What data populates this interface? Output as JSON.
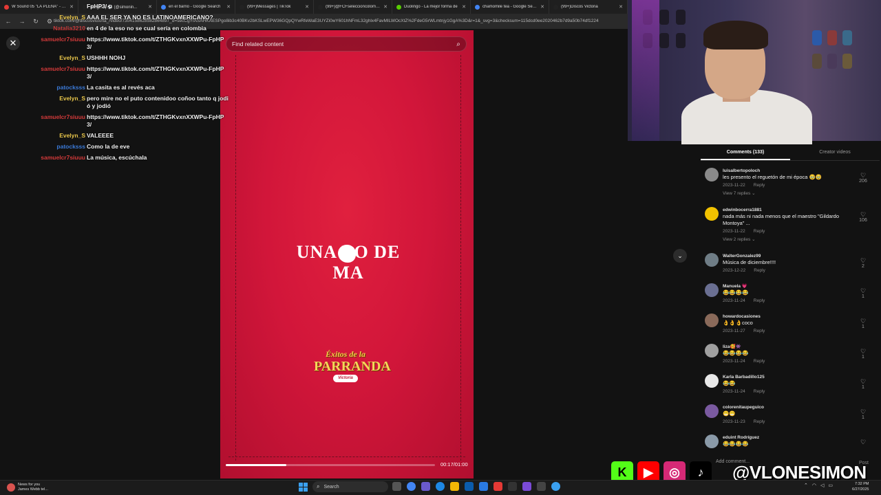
{
  "browser": {
    "tabs": [
      {
        "label": "W Sound 05 \"LA PLENA\" - Bedi",
        "color": "#e53935"
      },
      {
        "label": "(English) ⚽ (@simonin...",
        "color": "#222222"
      },
      {
        "label": "en el barrio - Google Search",
        "color": "#4285f4"
      },
      {
        "label": "(99+)Messages | TikTok",
        "color": "#222222"
      },
      {
        "label": "(99+)@FCFseleccioncolombia |",
        "color": "#222222"
      },
      {
        "label": "Duolingo - La mejor forma de",
        "color": "#58cc02"
      },
      {
        "label": "chamomile tea - Google Search",
        "color": "#4285f4"
      },
      {
        "label": "(99+)Discos Victoria",
        "color": "#222222"
      }
    ],
    "url": "tiktok.com/@discosvictoria_/video/7304158628582864897_d=secCgYIASAHKAESPgo8ib3c40BKv2bKSLwEPW36GQpQYwRfeWaE3UYZi0wY601hNFmL32ghlx4FavMILWOcXtZ%2FdeG5rWLmtnjy1GgA%3D&r=1&_svg=3&checksum=115dcd0ee2020462b7d9a50b74df1224"
  },
  "chat": [
    {
      "user": "",
      "message": "FpHP3/",
      "color": "#ffffff"
    },
    {
      "user": "Evelyn_S",
      "message": "AAA EL SER YA NO ES LATINOAMERICANO?",
      "color": "#e8c54a"
    },
    {
      "user": "Natalia3210",
      "message": "en 4 de la eso no se cual sería en colombia",
      "color": "#c43b3b"
    },
    {
      "user": "samuelcr7siuuu",
      "message": "https://www.tiktok.com/t/ZTHGKvxnXXWPu-FpHP3/",
      "color": "#d43a3a"
    },
    {
      "user": "Evelyn_S",
      "message": "USHHH NOHJ",
      "color": "#e8c54a"
    },
    {
      "user": "samuelcr7siuuu",
      "message": "https://www.tiktok.com/t/ZTHGKvxnXXWPu-FpHP3/",
      "color": "#d43a3a"
    },
    {
      "user": "patocksss",
      "message": "La casita es al revés aca",
      "color": "#3b7ad8"
    },
    {
      "user": "Evelyn_S",
      "message": "pero mire no el puto contenidoo coñoo tanto q jodió y jodió",
      "color": "#e8c54a"
    },
    {
      "user": "samuelcr7siuuu",
      "message": "https://www.tiktok.com/t/ZTHGKvxnXXWPu-FpHP3/",
      "color": "#d43a3a"
    },
    {
      "user": "Evelyn_S",
      "message": "VALEEEE",
      "color": "#e8c54a"
    },
    {
      "user": "patocksss",
      "message": "Como la de eve",
      "color": "#3b7ad8"
    },
    {
      "user": "samuelcr7siuuu",
      "message": "La música, escúchala",
      "color": "#d43a3a"
    }
  ],
  "video": {
    "search_placeholder": "Find related content",
    "overlay_text": "UNA BO  DE MA",
    "logo_line1": "Éxitos de la",
    "logo_line2": "PARRANDA",
    "logo_badge": "Victoria",
    "time": "00:17/01:00",
    "progress": 0.29
  },
  "comments_panel": {
    "tab_comments": "Comments (133)",
    "tab_creator": "Creator videos",
    "input_placeholder": "Add comment...",
    "post_label": "Post",
    "reply_label": "Reply",
    "comments": [
      {
        "user": "luisalbertopoloch",
        "text": "les presento el reguetón de mi época 🥹🥹",
        "date": "2023-11-22",
        "likes": "206",
        "replies": "View 7 replies ⌄",
        "avatar": "#8a8a8a"
      },
      {
        "user": "edwinbocerra1881",
        "text": "nada más ni nada menos que el maestro \"Gildardo Montoya\" ...",
        "date": "2023-11-22",
        "likes": "106",
        "replies": "View 2 replies ⌄",
        "avatar": "#f2c200"
      },
      {
        "user": "WalterGonzalez99",
        "text": "Música de diciembre!!!!",
        "date": "2023-12-22",
        "likes": "2",
        "replies": "",
        "avatar": "#6f7d86"
      },
      {
        "user": "Manuela 💗",
        "text": "😂😂😂😂",
        "date": "2023-11-24",
        "likes": "1",
        "replies": "",
        "avatar": "#6a6f92"
      },
      {
        "user": "howardocasiones",
        "text": "👌👌👌coco",
        "date": "2023-11-27",
        "likes": "1",
        "replies": "",
        "avatar": "#8a6a5a"
      },
      {
        "user": "liza🥰👾",
        "text": "😂😂😂😂",
        "date": "2023-11-24",
        "likes": "1",
        "replies": "",
        "avatar": "#a0a0a0"
      },
      {
        "user": "Karla Barbadillo125",
        "text": "😂😂",
        "date": "2023-11-24",
        "likes": "1",
        "replies": "",
        "avatar": "#e8e8e8"
      },
      {
        "user": "colorenitaupeguico",
        "text": "😁😁",
        "date": "2023-11-23",
        "likes": "1",
        "replies": "",
        "avatar": "#7a5aa0"
      },
      {
        "user": "eduint Rodríguez",
        "text": "😂😂😂😂",
        "date": "",
        "likes": "",
        "replies": "",
        "avatar": "#8a9aa8"
      }
    ]
  },
  "social": {
    "handle": "@VLONESIMON",
    "kick_color": "#53fc18",
    "youtube_color": "#ff0000",
    "instagram_color": "#d62976",
    "tiktok_color": "#000000"
  },
  "taskbar": {
    "news_title": "News for you",
    "news_sub": "James Webb tel...",
    "search_label": "Search",
    "time": "7:32 PM",
    "date": "6/27/2025"
  }
}
